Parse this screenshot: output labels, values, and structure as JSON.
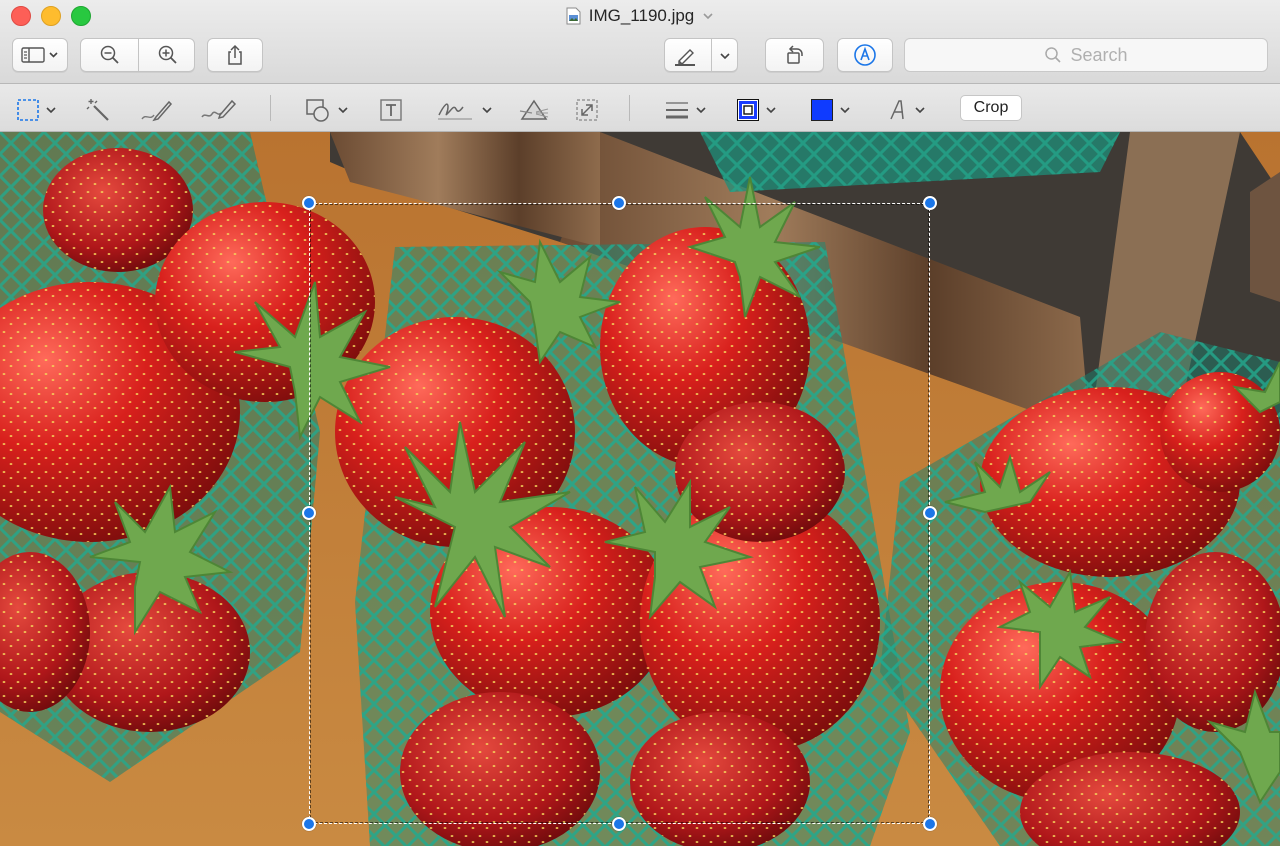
{
  "window": {
    "title": "IMG_1190.jpg",
    "icons": {
      "close": "close-button",
      "minimize": "minimize-button",
      "zoom": "zoom-button",
      "document": "image-document-icon",
      "title_menu": "chevron-down-icon"
    }
  },
  "toolbar": {
    "buttons": [
      {
        "name": "sidebar-view-button",
        "icon": "sidebar-icon"
      },
      {
        "name": "zoom-out-button",
        "icon": "zoom-out-icon"
      },
      {
        "name": "zoom-in-button",
        "icon": "zoom-in-icon"
      },
      {
        "name": "share-button",
        "icon": "share-icon"
      },
      {
        "name": "highlight-button",
        "icon": "highlighter-icon"
      },
      {
        "name": "rotate-button",
        "icon": "rotate-left-icon"
      },
      {
        "name": "markup-toolbar-button",
        "icon": "markup-pen-icon"
      }
    ],
    "search": {
      "placeholder": "Search",
      "icon": "search-icon"
    }
  },
  "markup": {
    "tools": [
      {
        "name": "selection-tool",
        "icon": "rect-selection-icon"
      },
      {
        "name": "instant-alpha-tool",
        "icon": "magic-wand-icon"
      },
      {
        "name": "sketch-tool",
        "icon": "sketch-pen-icon"
      },
      {
        "name": "draw-tool",
        "icon": "draw-brush-icon"
      },
      {
        "name": "shapes-tool",
        "icon": "shapes-icon"
      },
      {
        "name": "text-tool",
        "icon": "text-box-icon"
      },
      {
        "name": "sign-tool",
        "icon": "signature-icon"
      },
      {
        "name": "adjust-color-tool",
        "icon": "prism-icon"
      },
      {
        "name": "adjust-size-tool",
        "icon": "resize-icon"
      },
      {
        "name": "shape-style-tool",
        "icon": "line-weight-icon"
      },
      {
        "name": "border-color-tool",
        "icon": "border-color-icon"
      },
      {
        "name": "fill-color-tool",
        "icon": "fill-color-icon"
      },
      {
        "name": "text-style-tool",
        "icon": "text-style-icon"
      }
    ],
    "crop_label": "Crop",
    "colors": {
      "border": "#1a3cff",
      "fill": "#0f3bff",
      "accent": "#1b76e8"
    }
  },
  "canvas": {
    "image": "strawberries-photo",
    "selection": "crop-selection"
  }
}
